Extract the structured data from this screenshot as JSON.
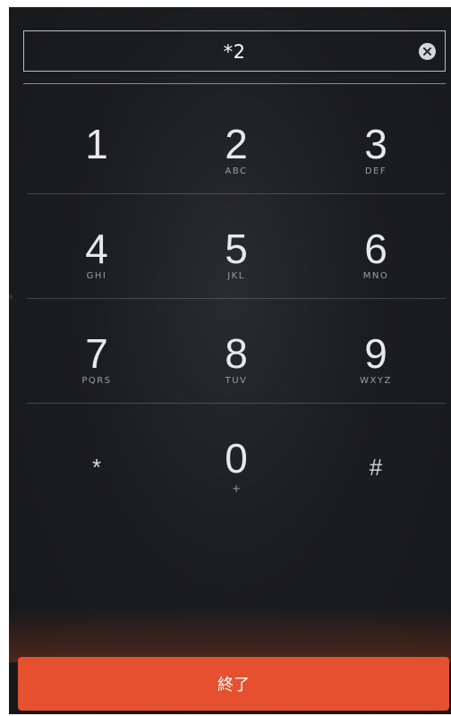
{
  "dial": {
    "entry_value": "*2"
  },
  "keypad": {
    "rows": [
      [
        {
          "digit": "1",
          "letters": ""
        },
        {
          "digit": "2",
          "letters": "ABC"
        },
        {
          "digit": "3",
          "letters": "DEF"
        }
      ],
      [
        {
          "digit": "4",
          "letters": "GHI"
        },
        {
          "digit": "5",
          "letters": "JKL"
        },
        {
          "digit": "6",
          "letters": "MNO"
        }
      ],
      [
        {
          "digit": "7",
          "letters": "PQRS"
        },
        {
          "digit": "8",
          "letters": "TUV"
        },
        {
          "digit": "9",
          "letters": "WXYZ"
        }
      ],
      [
        {
          "digit": "*",
          "letters": ""
        },
        {
          "digit": "0",
          "letters": "+"
        },
        {
          "digit": "#",
          "letters": ""
        }
      ]
    ]
  },
  "end_call": {
    "label": "終了"
  },
  "colors": {
    "end_button": "#e5502e",
    "background": "#1c1d20"
  },
  "icons": {
    "clear": "clear-icon"
  }
}
